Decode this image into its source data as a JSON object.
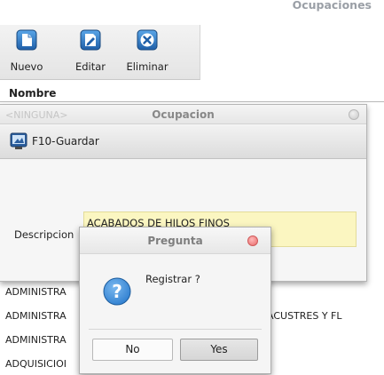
{
  "window": {
    "title": "Ocupaciones"
  },
  "toolbar": {
    "nuevo_label": "Nuevo",
    "editar_label": "Editar",
    "eliminar_label": "Eliminar"
  },
  "table": {
    "column_header": "Nombre",
    "filter_placeholder": "<NINGUNA>",
    "rows": [
      "ADMINISTRA",
      "ADMINISTRA",
      "ADMINISTRA",
      "ADQUISICIOI"
    ],
    "partial_right_text": "ACUSTRES Y FL"
  },
  "ocupacion_dialog": {
    "title": "Ocupacion",
    "save_label": "F10-Guardar",
    "descripcion_label": "Descripcion",
    "descripcion_value": "ACABADOS DE HILOS FINOS"
  },
  "pregunta_dialog": {
    "title": "Pregunta",
    "message": "Registrar ?",
    "no_label": "No",
    "yes_label": "Yes"
  },
  "colors": {
    "input_bg": "#fbf6c1",
    "close_button_active": "#e86a6a",
    "question_icon": "#2f7fd0"
  },
  "icons": {
    "nuevo": "new-document-icon",
    "editar": "edit-document-icon",
    "eliminar": "delete-x-icon",
    "guardar": "save-monitor-icon",
    "pregunta": "question-icon"
  }
}
